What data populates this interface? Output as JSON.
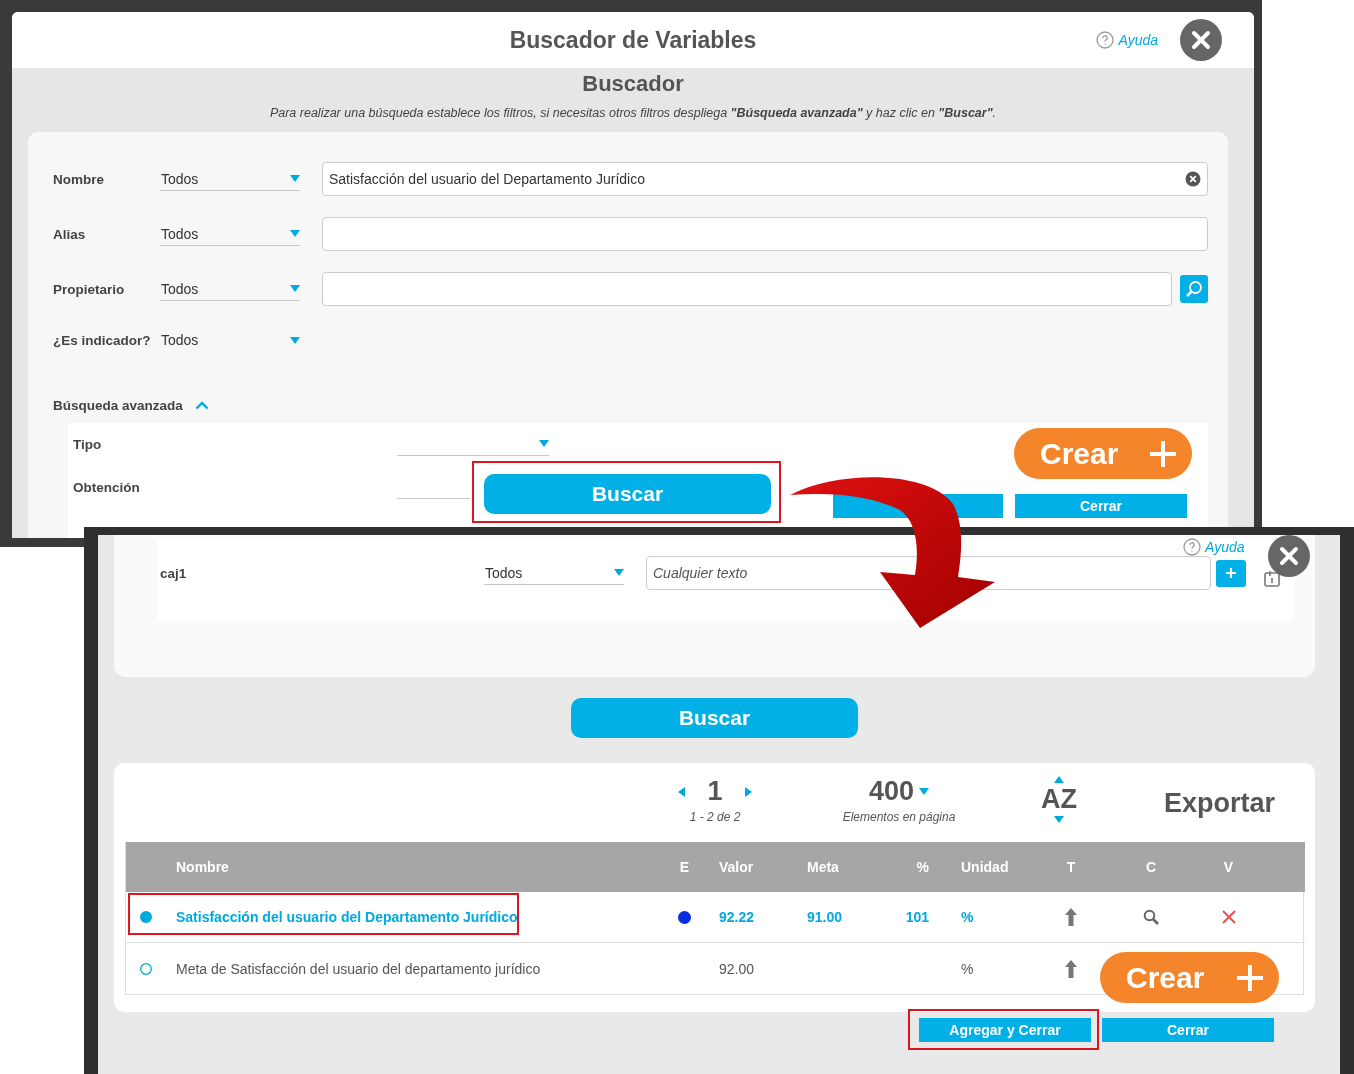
{
  "top_window": {
    "title": "Buscador de Variables",
    "help": "Ayuda",
    "heading": "Buscador",
    "instructions": "Para realizar una búsqueda establece los filtros, si necesitas otros filtros despliega **\"Búsqueda avanzada\"** y haz clic en **\"Buscar\"**.",
    "filters": [
      {
        "label": "Nombre",
        "operator": "Todos",
        "kind": "text",
        "value": "Satisfacción del usuario del Departamento Jurídico",
        "clearable": true
      },
      {
        "label": "Alias",
        "operator": "Todos",
        "kind": "text",
        "clearable": false
      },
      {
        "label": "Propietario",
        "operator": "Todos",
        "kind": "lookup",
        "clearable": false
      },
      {
        "label": "¿Es indicador?",
        "operator": "Todos",
        "kind": "select",
        "clearable": false
      }
    ],
    "advanced": {
      "label": "Búsqueda avanzada",
      "expanded": true,
      "fields": [
        {
          "label": "Tipo"
        },
        {
          "label": "Obtención"
        }
      ]
    },
    "search_button": {
      "label": "Buscar",
      "highlighted": true
    },
    "create_button": "Crear",
    "close_button": "Cerrar"
  },
  "bottom_window": {
    "help": "Ayuda",
    "custom_field": {
      "label": "caj1",
      "operator": "Todos",
      "placeholder": "Cualquier texto"
    },
    "search_button": "Buscar",
    "pager": {
      "page": "1",
      "range": "1 - 2 de 2",
      "page_size": "400",
      "page_size_label": "Elementos en página",
      "sort": "AZ",
      "export": "Exportar"
    },
    "table": {
      "columns": [
        "Nombre",
        "E",
        "Valor",
        "Meta",
        "%",
        "Unidad",
        "T",
        "C",
        "V"
      ],
      "rows": [
        {
          "selected": true,
          "highlighted": true,
          "name": "Satisfacción del usuario del Departamento Jurídico",
          "color": "#0a2be0",
          "valor": "92.22",
          "meta": "91.00",
          "percent": "101",
          "unidad": "%",
          "actions": [
            {
              "kind": "search"
            },
            {
              "kind": "delete"
            }
          ]
        },
        {
          "selected": false,
          "highlighted": false,
          "name": "Meta de Satisfacción del usuario del departamento jurídico",
          "valor": "92.00",
          "unidad": "%"
        }
      ]
    },
    "create_button": "Crear",
    "add_close_button": {
      "label": "Agregar y Cerrar",
      "highlighted": true
    },
    "close_button": "Cerrar"
  }
}
